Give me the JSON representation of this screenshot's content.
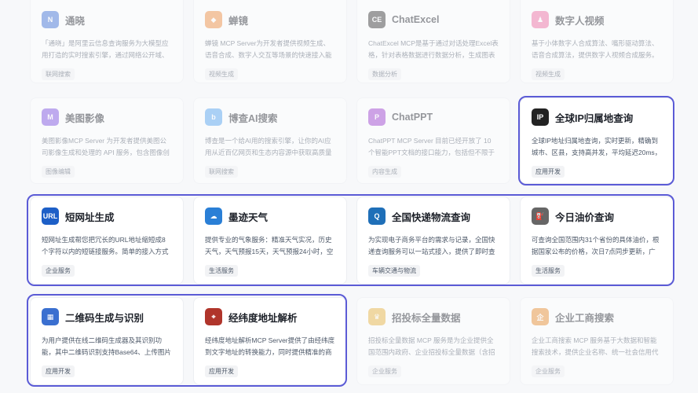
{
  "cards": [
    {
      "name": "通晓",
      "desc": "「通晓」是阿里云信息查询服务为大模型应用打造的实时搜索引擎，通过网络公开域、",
      "tag": "联网搜索",
      "icon": "tongxiao-logo-icon",
      "color": "#3b6fd6",
      "glyph": "N",
      "dim": true
    },
    {
      "name": "蝉镜",
      "desc": "蝉镜 MCP Server为开发者提供视频生成、语音合成、数字人交互等场景的快速接入能",
      "tag": "视频生成",
      "icon": "chanjing-logo-icon",
      "color": "#f08a3c",
      "glyph": "◆",
      "dim": true
    },
    {
      "name": "ChatExcel",
      "desc": "ChatExcel MCP是基于通过对话处理Excel表格，针对表格数据进行数据分析，生成图表",
      "tag": "数据分析",
      "icon": "chatexcel-logo-icon",
      "color": "#333333",
      "glyph": "CE",
      "dim": true
    },
    {
      "name": "数字人视频",
      "desc": "基于小体数字人合成算法、嘴形驱动算法、语音合成算法，提供数字人视频合成服务。",
      "tag": "视频生成",
      "icon": "digital-human-logo-icon",
      "color": "#f06aa0",
      "glyph": "♟",
      "dim": true
    },
    {
      "name": "美图影像",
      "desc": "美图影像MCP Server 为开发者提供美图公司影像生成和处理的 API 服务，包含图像创",
      "tag": "图像编辑",
      "icon": "meitu-logo-icon",
      "color": "#7b4de0",
      "glyph": "M",
      "dim": true
    },
    {
      "name": "博查AI搜索",
      "desc": "博查是一个给AI用的搜索引擎，让你的AI应用从近百亿网页和生态内容源中获取高质量的",
      "tag": "联网搜索",
      "icon": "bocha-logo-icon",
      "color": "#4ea0f0",
      "glyph": "b",
      "dim": true
    },
    {
      "name": "ChatPPT",
      "desc": "ChatPPT MCP Server 目前已经开放了 10 个智能PPT文档的接口能力，包括但不限于 PP",
      "tag": "内容生成",
      "icon": "chatppt-logo-icon",
      "color": "#9b3bd0",
      "glyph": "P",
      "dim": true
    },
    {
      "name": "全球IP归属地查询",
      "desc": "全球IP地址归属地查询，实时更新，精确到城市、区县，支持高并发，平均延迟20ms，",
      "tag": "应用开发",
      "icon": "ip-location-logo-icon",
      "color": "#222222",
      "glyph": "IP",
      "dim": false
    },
    {
      "name": "短网址生成",
      "desc": "短网址生成帮您把冗长的URL地址缩短成8个字符以内的短链接服务。简单的接入方式可",
      "tag": "企业服务",
      "icon": "short-url-logo-icon",
      "color": "#1d5fc7",
      "glyph": "URL",
      "dim": false
    },
    {
      "name": "墨迹天气",
      "desc": "提供专业的气象服务：精准天气实况，历史天气，天气预报15天，天气预报24小时，空",
      "tag": "生活服务",
      "icon": "moji-weather-logo-icon",
      "color": "#2a7fd6",
      "glyph": "☁",
      "dim": false
    },
    {
      "name": "全国快递物流查询",
      "desc": "为实现电子商务平台的需求与记录，全国快递查询服务可以一站式接入，提供了即时查",
      "tag": "车辆交通与物流",
      "icon": "express-logo-icon",
      "color": "#1f6fb8",
      "glyph": "Q",
      "dim": false
    },
    {
      "name": "今日油价查询",
      "desc": "可查询全国范围内31个省份的具体油价，根据国家公布的价格，次日7点同步更新，广",
      "tag": "生活服务",
      "icon": "fuel-price-logo-icon",
      "color": "#666666",
      "glyph": "⛽",
      "dim": false
    },
    {
      "name": "二维码生成与识别",
      "desc": "为用户提供在线二维码生成器及其识别功能，其中二维码识别支持Base64、上传图片",
      "tag": "应用开发",
      "icon": "qrcode-logo-icon",
      "color": "#3a6fd0",
      "glyph": "▦",
      "dim": false
    },
    {
      "name": "经纬度地址解析",
      "desc": "经纬度地址解析MCP Server提供了由经纬度到文字地址的转换能力，同时提供精准的商",
      "tag": "应用开发",
      "icon": "geocode-logo-icon",
      "color": "#b0352b",
      "glyph": "⌖",
      "dim": false
    },
    {
      "name": "招投标全量数据",
      "desc": "招投标全量数据 MCP 服务是为企业提供全国范围内政府、企业招投标全量数据（含招标、",
      "tag": "企业服务",
      "icon": "bidding-logo-icon",
      "color": "#e8b23a",
      "glyph": "♛",
      "dim": true
    },
    {
      "name": "企业工商搜索",
      "desc": "企业工商搜索 MCP 服务基于大数据和智能搜索技术，提供企业名称、统一社会信用代",
      "tag": "企业服务",
      "icon": "business-search-logo-icon",
      "color": "#e88a2a",
      "glyph": "企",
      "dim": true
    }
  ]
}
